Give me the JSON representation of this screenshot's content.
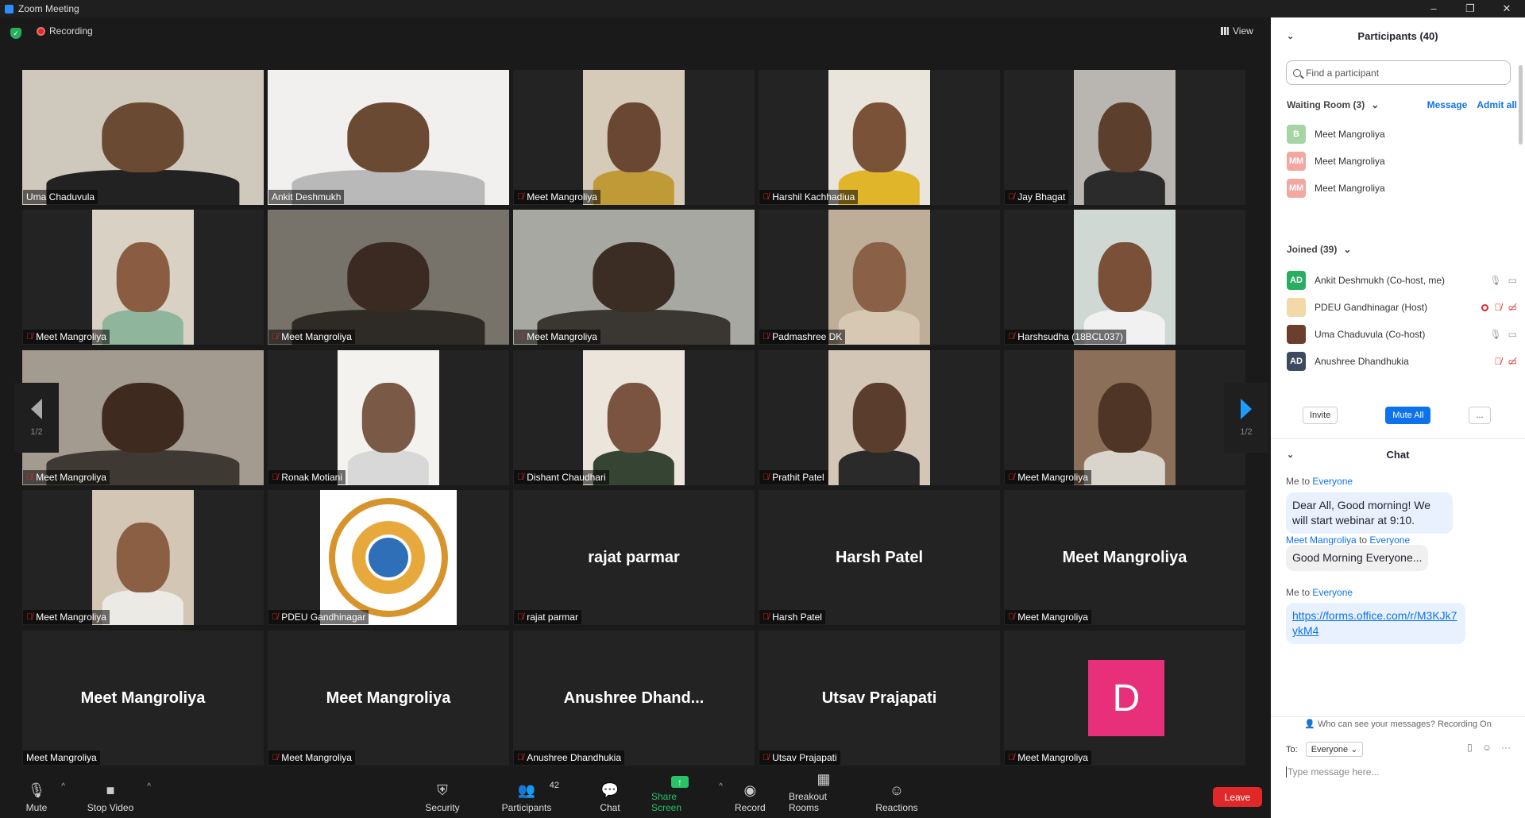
{
  "window": {
    "title": "Zoom Meeting",
    "controls": [
      "–",
      "❐",
      "✕"
    ]
  },
  "topbar": {
    "recording": "Recording",
    "view": "View"
  },
  "tiles": [
    {
      "name": "Uma Chaduvula",
      "muted": false,
      "kind": "wide",
      "bg": "#cfc8bd",
      "face": "#6b4a34",
      "shirt": "#222"
    },
    {
      "name": "Ankit Deshmukh",
      "muted": false,
      "kind": "wide",
      "bg": "#f1f0ee",
      "face": "#6b4a34",
      "shirt": "#b9b9b9",
      "active": true
    },
    {
      "name": "Meet Mangroliya",
      "muted": true,
      "kind": "narrow",
      "bg": "#d6cbb9",
      "face": "#6a4733",
      "shirt": "#c09a36"
    },
    {
      "name": "Harshil Kachhadiua",
      "muted": true,
      "kind": "narrow",
      "bg": "#e9e4dc",
      "face": "#7a5238",
      "shirt": "#e0b52a"
    },
    {
      "name": "Jay Bhagat",
      "muted": true,
      "kind": "narrow",
      "bg": "#b9b6b1",
      "face": "#5d3f2e",
      "shirt": "#2b2b2b"
    },
    {
      "name": "Meet Mangroliya",
      "muted": true,
      "kind": "narrow",
      "bg": "#d9d1c4",
      "face": "#8a5d42",
      "shirt": "#8fb69d"
    },
    {
      "name": "Meet Mangroliya",
      "muted": true,
      "kind": "wide",
      "bg": "#77736b",
      "face": "#3a2a22",
      "shirt": "#2e2b27"
    },
    {
      "name": "Meet Mangroliya",
      "muted": true,
      "kind": "wide",
      "bg": "#a8a8a2",
      "face": "#3b2c24",
      "shirt": "#3a3631"
    },
    {
      "name": "Padmashree DK",
      "muted": true,
      "kind": "narrow",
      "bg": "#bfae97",
      "face": "#8a6047",
      "shirt": "#d7c8b3"
    },
    {
      "name": "Harshsudha (18BCL037)",
      "muted": true,
      "kind": "narrow",
      "bg": "#cfd8d2",
      "face": "#7a5038",
      "shirt": "#f1f1f1"
    },
    {
      "name": "Meet Mangroliya",
      "muted": true,
      "kind": "wide",
      "bg": "#a39a90",
      "face": "#3f2a20",
      "shirt": "#3e3a33"
    },
    {
      "name": "Ronak Motiani",
      "muted": true,
      "kind": "narrow",
      "bg": "#f4f2ee",
      "face": "#7a5a46",
      "shirt": "#d8d8d8"
    },
    {
      "name": "Dishant Chaudhari",
      "muted": true,
      "kind": "narrow",
      "bg": "#ece5db",
      "face": "#7a5440",
      "shirt": "#364433"
    },
    {
      "name": "Prathit Patel",
      "muted": true,
      "kind": "narrow",
      "bg": "#d3c6b6",
      "face": "#5a3d2c",
      "shirt": "#2a2a2a"
    },
    {
      "name": "Meet Mangroliya",
      "muted": true,
      "kind": "narrow",
      "bg": "#8c6f58",
      "face": "#4e3526",
      "shirt": "#d9d4cc"
    },
    {
      "name": "Meet Mangroliya",
      "muted": true,
      "kind": "narrow",
      "bg": "#d3c6b5",
      "face": "#8a5f44",
      "shirt": "#eceae5"
    },
    {
      "name": "PDEU Gandhinagar",
      "muted": true,
      "kind": "logo"
    },
    {
      "name": "rajat parmar",
      "muted": true,
      "kind": "text",
      "big": "rajat parmar"
    },
    {
      "name": "Harsh Patel",
      "muted": true,
      "kind": "text",
      "big": "Harsh Patel"
    },
    {
      "name": "Meet Mangroliya",
      "muted": true,
      "kind": "text",
      "big": "Meet Mangroliya"
    },
    {
      "name": "Meet Mangroliya",
      "muted": false,
      "kind": "text",
      "big": "Meet Mangroliya"
    },
    {
      "name": "Meet Mangroliya",
      "muted": true,
      "kind": "text",
      "big": "Meet Mangroliya"
    },
    {
      "name": "Anushree Dhandhukia",
      "muted": true,
      "kind": "text",
      "big": "Anushree  Dhand..."
    },
    {
      "name": "Utsav Prajapati",
      "muted": true,
      "kind": "text",
      "big": "Utsav Prajapati"
    },
    {
      "name": "Meet Mangroliya",
      "muted": true,
      "kind": "avatar",
      "big": "D"
    }
  ],
  "pager": {
    "left": "1/2",
    "right": "1/2"
  },
  "toolbar": {
    "mute": "Mute",
    "stop_video": "Stop Video",
    "security": "Security",
    "participants": "Participants",
    "participants_count": "42",
    "chat": "Chat",
    "share": "Share Screen",
    "record": "Record",
    "breakout": "Breakout Rooms",
    "reactions": "Reactions",
    "leave": "Leave"
  },
  "panel": {
    "title": "Participants (40)",
    "search_placeholder": "Find a participant",
    "waiting": "Waiting Room (3)",
    "message": "Message",
    "admit_all": "Admit all",
    "waiting_list": [
      {
        "initials": "B",
        "color": "#a6d4a4",
        "name": "Meet Mangroliya"
      },
      {
        "initials": "MM",
        "color": "#f4a6a0",
        "name": "Meet Mangroliya"
      },
      {
        "initials": "MM",
        "color": "#f4a6a0",
        "name": "Meet Mangroliya"
      }
    ],
    "joined": "Joined (39)",
    "joined_list": [
      {
        "initials": "AD",
        "color": "#27ae60",
        "name": "Ankit Deshmukh (Co-host, me)"
      },
      {
        "initials": "",
        "color": "#f1d9a8",
        "name": "PDEU Gandhinagar (Host)"
      },
      {
        "initials": "",
        "color": "#6b3e2d",
        "name": "Uma Chaduvula (Co-host)"
      },
      {
        "initials": "AD",
        "color": "#3b4a5e",
        "name": "Anushree Dhandhukia"
      }
    ],
    "invite": "Invite",
    "mute_all": "Mute All",
    "more": "..."
  },
  "chat": {
    "title": "Chat",
    "messages": [
      {
        "from": "Me",
        "to_word": "to",
        "to": "Everyone",
        "text": "Dear All, Good morning! We will start webinar at 9:10."
      },
      {
        "from": "Meet Mangroliya",
        "to_word": "to",
        "to": "Everyone",
        "text": "Good Morning Everyone..."
      },
      {
        "from": "Me",
        "to_word": "to",
        "to": "Everyone",
        "text": "https://forms.office.com/r/M3KJk7ykM4"
      }
    ],
    "who_can_see": "Who can see your messages? Recording On",
    "to_label": "To:",
    "to_value": "Everyone",
    "placeholder": "Type message here..."
  }
}
